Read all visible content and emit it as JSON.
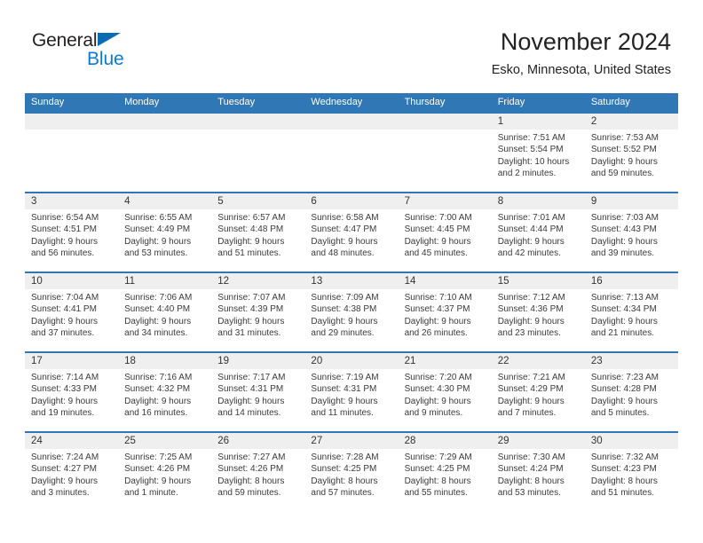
{
  "brand": {
    "name_part1": "General",
    "name_part2": "Blue",
    "flag_icon": "triangle-flag-icon",
    "accent_color": "#0a7bd4"
  },
  "header": {
    "title": "November 2024",
    "subtitle": "Esko, Minnesota, United States"
  },
  "theme": {
    "header_blue": "#3077b5",
    "date_strip_gray": "#efefef",
    "text_color": "#3a3a3a"
  },
  "weekdays": [
    "Sunday",
    "Monday",
    "Tuesday",
    "Wednesday",
    "Thursday",
    "Friday",
    "Saturday"
  ],
  "weeks": [
    {
      "days": [
        {
          "date": "",
          "sunrise": "",
          "sunset": "",
          "daylight_line1": "",
          "daylight_line2": "",
          "empty": true
        },
        {
          "date": "",
          "sunrise": "",
          "sunset": "",
          "daylight_line1": "",
          "daylight_line2": "",
          "empty": true
        },
        {
          "date": "",
          "sunrise": "",
          "sunset": "",
          "daylight_line1": "",
          "daylight_line2": "",
          "empty": true
        },
        {
          "date": "",
          "sunrise": "",
          "sunset": "",
          "daylight_line1": "",
          "daylight_line2": "",
          "empty": true
        },
        {
          "date": "",
          "sunrise": "",
          "sunset": "",
          "daylight_line1": "",
          "daylight_line2": "",
          "empty": true
        },
        {
          "date": "1",
          "sunrise": "Sunrise: 7:51 AM",
          "sunset": "Sunset: 5:54 PM",
          "daylight_line1": "Daylight: 10 hours",
          "daylight_line2": "and 2 minutes.",
          "empty": false
        },
        {
          "date": "2",
          "sunrise": "Sunrise: 7:53 AM",
          "sunset": "Sunset: 5:52 PM",
          "daylight_line1": "Daylight: 9 hours",
          "daylight_line2": "and 59 minutes.",
          "empty": false
        }
      ]
    },
    {
      "days": [
        {
          "date": "3",
          "sunrise": "Sunrise: 6:54 AM",
          "sunset": "Sunset: 4:51 PM",
          "daylight_line1": "Daylight: 9 hours",
          "daylight_line2": "and 56 minutes.",
          "empty": false
        },
        {
          "date": "4",
          "sunrise": "Sunrise: 6:55 AM",
          "sunset": "Sunset: 4:49 PM",
          "daylight_line1": "Daylight: 9 hours",
          "daylight_line2": "and 53 minutes.",
          "empty": false
        },
        {
          "date": "5",
          "sunrise": "Sunrise: 6:57 AM",
          "sunset": "Sunset: 4:48 PM",
          "daylight_line1": "Daylight: 9 hours",
          "daylight_line2": "and 51 minutes.",
          "empty": false
        },
        {
          "date": "6",
          "sunrise": "Sunrise: 6:58 AM",
          "sunset": "Sunset: 4:47 PM",
          "daylight_line1": "Daylight: 9 hours",
          "daylight_line2": "and 48 minutes.",
          "empty": false
        },
        {
          "date": "7",
          "sunrise": "Sunrise: 7:00 AM",
          "sunset": "Sunset: 4:45 PM",
          "daylight_line1": "Daylight: 9 hours",
          "daylight_line2": "and 45 minutes.",
          "empty": false
        },
        {
          "date": "8",
          "sunrise": "Sunrise: 7:01 AM",
          "sunset": "Sunset: 4:44 PM",
          "daylight_line1": "Daylight: 9 hours",
          "daylight_line2": "and 42 minutes.",
          "empty": false
        },
        {
          "date": "9",
          "sunrise": "Sunrise: 7:03 AM",
          "sunset": "Sunset: 4:43 PM",
          "daylight_line1": "Daylight: 9 hours",
          "daylight_line2": "and 39 minutes.",
          "empty": false
        }
      ]
    },
    {
      "days": [
        {
          "date": "10",
          "sunrise": "Sunrise: 7:04 AM",
          "sunset": "Sunset: 4:41 PM",
          "daylight_line1": "Daylight: 9 hours",
          "daylight_line2": "and 37 minutes.",
          "empty": false
        },
        {
          "date": "11",
          "sunrise": "Sunrise: 7:06 AM",
          "sunset": "Sunset: 4:40 PM",
          "daylight_line1": "Daylight: 9 hours",
          "daylight_line2": "and 34 minutes.",
          "empty": false
        },
        {
          "date": "12",
          "sunrise": "Sunrise: 7:07 AM",
          "sunset": "Sunset: 4:39 PM",
          "daylight_line1": "Daylight: 9 hours",
          "daylight_line2": "and 31 minutes.",
          "empty": false
        },
        {
          "date": "13",
          "sunrise": "Sunrise: 7:09 AM",
          "sunset": "Sunset: 4:38 PM",
          "daylight_line1": "Daylight: 9 hours",
          "daylight_line2": "and 29 minutes.",
          "empty": false
        },
        {
          "date": "14",
          "sunrise": "Sunrise: 7:10 AM",
          "sunset": "Sunset: 4:37 PM",
          "daylight_line1": "Daylight: 9 hours",
          "daylight_line2": "and 26 minutes.",
          "empty": false
        },
        {
          "date": "15",
          "sunrise": "Sunrise: 7:12 AM",
          "sunset": "Sunset: 4:36 PM",
          "daylight_line1": "Daylight: 9 hours",
          "daylight_line2": "and 23 minutes.",
          "empty": false
        },
        {
          "date": "16",
          "sunrise": "Sunrise: 7:13 AM",
          "sunset": "Sunset: 4:34 PM",
          "daylight_line1": "Daylight: 9 hours",
          "daylight_line2": "and 21 minutes.",
          "empty": false
        }
      ]
    },
    {
      "days": [
        {
          "date": "17",
          "sunrise": "Sunrise: 7:14 AM",
          "sunset": "Sunset: 4:33 PM",
          "daylight_line1": "Daylight: 9 hours",
          "daylight_line2": "and 19 minutes.",
          "empty": false
        },
        {
          "date": "18",
          "sunrise": "Sunrise: 7:16 AM",
          "sunset": "Sunset: 4:32 PM",
          "daylight_line1": "Daylight: 9 hours",
          "daylight_line2": "and 16 minutes.",
          "empty": false
        },
        {
          "date": "19",
          "sunrise": "Sunrise: 7:17 AM",
          "sunset": "Sunset: 4:31 PM",
          "daylight_line1": "Daylight: 9 hours",
          "daylight_line2": "and 14 minutes.",
          "empty": false
        },
        {
          "date": "20",
          "sunrise": "Sunrise: 7:19 AM",
          "sunset": "Sunset: 4:31 PM",
          "daylight_line1": "Daylight: 9 hours",
          "daylight_line2": "and 11 minutes.",
          "empty": false
        },
        {
          "date": "21",
          "sunrise": "Sunrise: 7:20 AM",
          "sunset": "Sunset: 4:30 PM",
          "daylight_line1": "Daylight: 9 hours",
          "daylight_line2": "and 9 minutes.",
          "empty": false
        },
        {
          "date": "22",
          "sunrise": "Sunrise: 7:21 AM",
          "sunset": "Sunset: 4:29 PM",
          "daylight_line1": "Daylight: 9 hours",
          "daylight_line2": "and 7 minutes.",
          "empty": false
        },
        {
          "date": "23",
          "sunrise": "Sunrise: 7:23 AM",
          "sunset": "Sunset: 4:28 PM",
          "daylight_line1": "Daylight: 9 hours",
          "daylight_line2": "and 5 minutes.",
          "empty": false
        }
      ]
    },
    {
      "days": [
        {
          "date": "24",
          "sunrise": "Sunrise: 7:24 AM",
          "sunset": "Sunset: 4:27 PM",
          "daylight_line1": "Daylight: 9 hours",
          "daylight_line2": "and 3 minutes.",
          "empty": false
        },
        {
          "date": "25",
          "sunrise": "Sunrise: 7:25 AM",
          "sunset": "Sunset: 4:26 PM",
          "daylight_line1": "Daylight: 9 hours",
          "daylight_line2": "and 1 minute.",
          "empty": false
        },
        {
          "date": "26",
          "sunrise": "Sunrise: 7:27 AM",
          "sunset": "Sunset: 4:26 PM",
          "daylight_line1": "Daylight: 8 hours",
          "daylight_line2": "and 59 minutes.",
          "empty": false
        },
        {
          "date": "27",
          "sunrise": "Sunrise: 7:28 AM",
          "sunset": "Sunset: 4:25 PM",
          "daylight_line1": "Daylight: 8 hours",
          "daylight_line2": "and 57 minutes.",
          "empty": false
        },
        {
          "date": "28",
          "sunrise": "Sunrise: 7:29 AM",
          "sunset": "Sunset: 4:25 PM",
          "daylight_line1": "Daylight: 8 hours",
          "daylight_line2": "and 55 minutes.",
          "empty": false
        },
        {
          "date": "29",
          "sunrise": "Sunrise: 7:30 AM",
          "sunset": "Sunset: 4:24 PM",
          "daylight_line1": "Daylight: 8 hours",
          "daylight_line2": "and 53 minutes.",
          "empty": false
        },
        {
          "date": "30",
          "sunrise": "Sunrise: 7:32 AM",
          "sunset": "Sunset: 4:23 PM",
          "daylight_line1": "Daylight: 8 hours",
          "daylight_line2": "and 51 minutes.",
          "empty": false
        }
      ]
    }
  ]
}
